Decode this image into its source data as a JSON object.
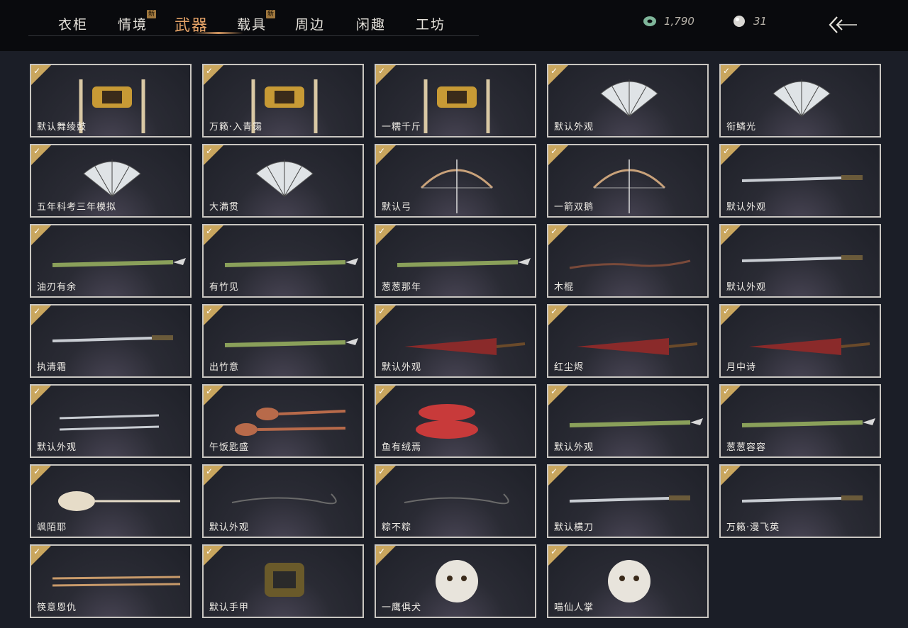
{
  "tabs": [
    {
      "label": "衣柜",
      "badge": ""
    },
    {
      "label": "情境",
      "badge": "新"
    },
    {
      "label": "武器",
      "badge": "",
      "active": true
    },
    {
      "label": "载具",
      "badge": "新"
    },
    {
      "label": "周边",
      "badge": ""
    },
    {
      "label": "闲趣",
      "badge": ""
    },
    {
      "label": "工坊",
      "badge": ""
    }
  ],
  "currency": {
    "jade": "1,790",
    "pearl": "31"
  },
  "items": [
    {
      "label": "默认舞绫鼓",
      "icon": "drum"
    },
    {
      "label": "万籁·入青霭",
      "icon": "drum"
    },
    {
      "label": "一糯千斤",
      "icon": "drum"
    },
    {
      "label": "默认外观",
      "icon": "fan"
    },
    {
      "label": "衔鳞光",
      "icon": "fan"
    },
    {
      "label": "五年科考三年模拟",
      "icon": "fan"
    },
    {
      "label": "大满贯",
      "icon": "fan"
    },
    {
      "label": "默认弓",
      "icon": "bow"
    },
    {
      "label": "一箭双鹅",
      "icon": "bow"
    },
    {
      "label": "默认外观",
      "icon": "sword"
    },
    {
      "label": "油刃有余",
      "icon": "spear"
    },
    {
      "label": "有竹见",
      "icon": "spear"
    },
    {
      "label": "葱葱那年",
      "icon": "spear"
    },
    {
      "label": "木棍",
      "icon": "staff"
    },
    {
      "label": "默认外观",
      "icon": "sword"
    },
    {
      "label": "执清霜",
      "icon": "sword"
    },
    {
      "label": "出竹意",
      "icon": "spear"
    },
    {
      "label": "默认外观",
      "icon": "umbrella"
    },
    {
      "label": "红尘烬",
      "icon": "umbrella"
    },
    {
      "label": "月中诗",
      "icon": "umbrella"
    },
    {
      "label": "默认外观",
      "icon": "dual-blades"
    },
    {
      "label": "午饭匙盛",
      "icon": "spoons"
    },
    {
      "label": "鱼有绒焉",
      "icon": "fish"
    },
    {
      "label": "默认外观",
      "icon": "spear"
    },
    {
      "label": "葱葱容容",
      "icon": "spear"
    },
    {
      "label": "飒陌耶",
      "icon": "spoon"
    },
    {
      "label": "默认外观",
      "icon": "chain"
    },
    {
      "label": "粽不粽",
      "icon": "chain"
    },
    {
      "label": "默认横刀",
      "icon": "sword"
    },
    {
      "label": "万籁·漫飞英",
      "icon": "sword"
    },
    {
      "label": "筷意恩仇",
      "icon": "chopsticks"
    },
    {
      "label": "默认手甲",
      "icon": "gauntlet"
    },
    {
      "label": "一鹰俱犬",
      "icon": "mug"
    },
    {
      "label": "喵仙人掌",
      "icon": "mug"
    }
  ],
  "colors": {
    "accent": "#e6a468",
    "check": "#c9a65e",
    "card_border": "#c9c6c1"
  }
}
